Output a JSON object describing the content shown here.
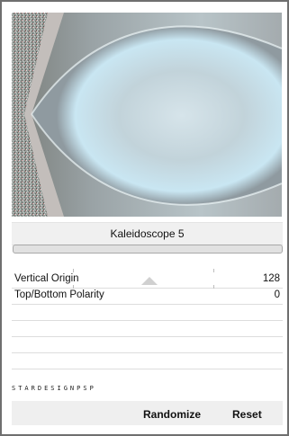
{
  "filter": {
    "name": "Kaleidoscope 5"
  },
  "progress": {
    "value": 0
  },
  "params": [
    {
      "label": "Vertical Origin",
      "value": "128"
    },
    {
      "label": "Top/Bottom Polarity",
      "value": "0"
    }
  ],
  "signature": "STARDESIGNPSP",
  "footer": {
    "randomize_label": "Randomize",
    "reset_label": "Reset"
  }
}
